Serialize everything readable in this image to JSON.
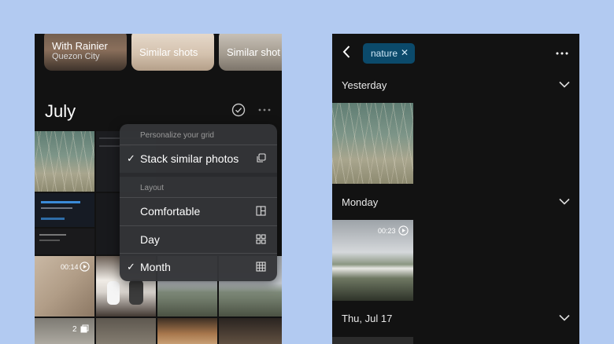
{
  "left": {
    "albums": [
      {
        "title": "With Rainier",
        "subtitle": "Quezon City"
      },
      {
        "title": "Similar shots"
      },
      {
        "title": "Similar shot"
      }
    ],
    "month_title": "July",
    "videos": [
      {
        "duration": "00:14"
      }
    ],
    "stack_count": "2",
    "menu": {
      "section1": "Personalize your grid",
      "stack_label": "Stack similar photos",
      "section2": "Layout",
      "options": [
        {
          "label": "Comfortable",
          "checked": false,
          "icon": "comfortable-layout-icon"
        },
        {
          "label": "Day",
          "checked": false,
          "icon": "day-layout-icon"
        },
        {
          "label": "Month",
          "checked": true,
          "icon": "month-layout-icon"
        }
      ]
    }
  },
  "right": {
    "filter_chip": "nature",
    "days": [
      {
        "label": "Yesterday"
      },
      {
        "label": "Monday",
        "duration": "00:23"
      },
      {
        "label": "Thu, Jul 17"
      }
    ]
  },
  "colors": {
    "background": "#b2caf1",
    "app_bg": "#121212",
    "chip_bg": "#0b4a6b",
    "menu_bg": "#343538"
  }
}
